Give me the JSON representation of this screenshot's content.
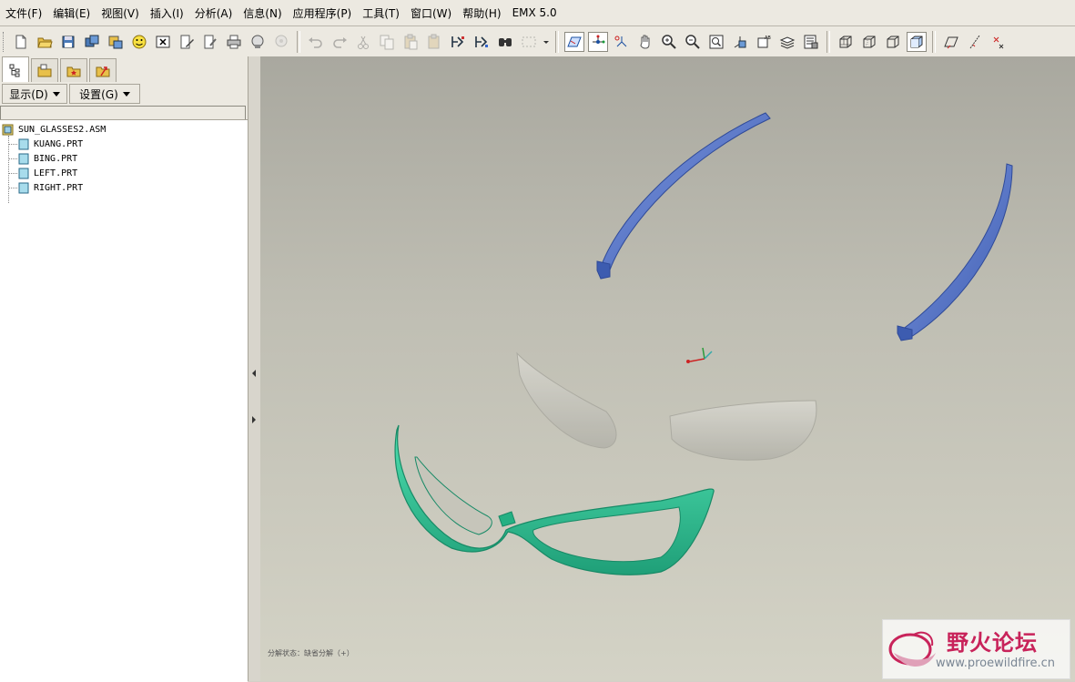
{
  "menubar": {
    "items": [
      "文件(F)",
      "编辑(E)",
      "视图(V)",
      "插入(I)",
      "分析(A)",
      "信息(N)",
      "应用程序(P)",
      "工具(T)",
      "窗口(W)",
      "帮助(H)",
      "EMX 5.0"
    ]
  },
  "toolbar": {
    "icons": [
      "new-icon",
      "open-icon",
      "save-icon",
      "save-copy-icon",
      "backup-icon",
      "smiley-icon",
      "close-window-icon",
      "edit-text-icon",
      "print-preview-icon",
      "print-icon",
      "send-icon",
      "disabled-icon",
      "undo-icon",
      "redo-icon",
      "cut-icon",
      "copy-icon",
      "paste-icon",
      "paste-special-icon",
      "regenerate-icon",
      "regen-manager-icon",
      "search-icon",
      "select-box-icon",
      "datum-plane-icon",
      "axis-icon",
      "csys-icon",
      "pan-icon",
      "zoom-in-icon",
      "zoom-out-icon",
      "refit-icon",
      "reorient-icon",
      "named-views-icon",
      "layers-icon",
      "view-manager-icon",
      "wireframe-icon",
      "hidden-line-icon",
      "no-hidden-icon",
      "shading-icon",
      "plane-display-icon",
      "point-display-icon",
      "axis-display-icon"
    ]
  },
  "nav": {
    "tabs": [
      "model-tree-icon",
      "folder-browser-icon",
      "favorites-icon",
      "connections-icon"
    ],
    "display_label": "显示(D)",
    "settings_label": "设置(G)"
  },
  "tree": {
    "root": "SUN_GLASSES2.ASM",
    "children": [
      "KUANG.PRT",
      "BING.PRT",
      "LEFT.PRT",
      "RIGHT.PRT"
    ]
  },
  "viewport": {
    "status_text": "分解状态：缺省分解（+）",
    "colors": {
      "temples": "#5a78c8",
      "frame": "#2fbf92",
      "lens": "#c9c8c0"
    }
  },
  "watermark": {
    "name": "野火论坛",
    "url": "www.proewildfire.cn"
  }
}
